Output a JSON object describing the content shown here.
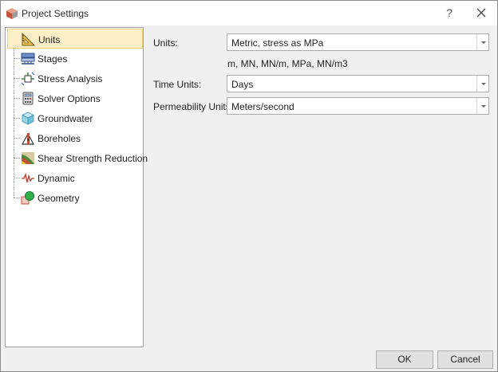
{
  "window": {
    "title": "Project Settings",
    "help_label": "?",
    "icon": "project-cube-icon"
  },
  "nav": {
    "items": [
      {
        "label": "Units",
        "icon": "units-triangle-ruler-icon",
        "selected": true
      },
      {
        "label": "Stages",
        "icon": "stages-icon",
        "selected": false
      },
      {
        "label": "Stress Analysis",
        "icon": "stress-analysis-icon",
        "selected": false
      },
      {
        "label": "Solver Options",
        "icon": "solver-calculator-icon",
        "selected": false
      },
      {
        "label": "Groundwater",
        "icon": "groundwater-cube-icon",
        "selected": false
      },
      {
        "label": "Boreholes",
        "icon": "borehole-icon",
        "selected": false
      },
      {
        "label": "Shear Strength Reduction",
        "icon": "shear-strength-reduction-icon",
        "selected": false
      },
      {
        "label": "Dynamic",
        "icon": "dynamic-wave-icon",
        "selected": false
      },
      {
        "label": "Geometry",
        "icon": "geometry-shapes-icon",
        "selected": false
      }
    ]
  },
  "form": {
    "units_label": "Units:",
    "units_value": "Metric, stress as MPa",
    "units_note": "m, MN, MN/m, MPa, MN/m3",
    "time_units_label": "Time Units:",
    "time_units_value": "Days",
    "permeability_label": "Permeability Units:",
    "permeability_value": "Meters/second"
  },
  "buttons": {
    "ok_label": "OK",
    "cancel_label": "Cancel"
  },
  "colors": {
    "selected_bg": "#fcefc7",
    "selected_border": "#f0d27a",
    "dialog_bg": "#f0f0f0"
  }
}
